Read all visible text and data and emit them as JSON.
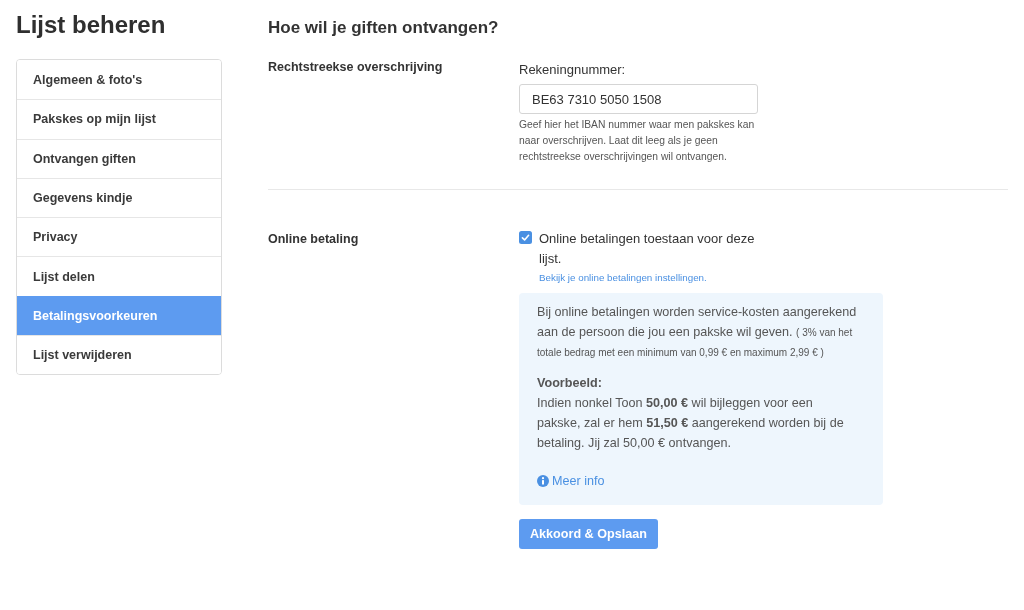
{
  "page_title": "Lijst beheren",
  "sidebar_items": [
    {
      "label": "Algemeen & foto's",
      "selected": false
    },
    {
      "label": "Pakskes op mijn lijst",
      "selected": false
    },
    {
      "label": "Ontvangen giften",
      "selected": false
    },
    {
      "label": "Gegevens kindje",
      "selected": false
    },
    {
      "label": "Privacy",
      "selected": false
    },
    {
      "label": "Lijst delen",
      "selected": false
    },
    {
      "label": "Betalingsvoorkeuren",
      "selected": true
    },
    {
      "label": "Lijst verwijderen",
      "selected": false
    }
  ],
  "heading": "Hoe wil je giften ontvangen?",
  "bank_transfer": {
    "label": "Rechtstreekse overschrijving",
    "field_label": "Rekeningnummer:",
    "value": "BE63 7310 5050 1508",
    "help": "Geef hier het IBAN nummer waar men pakskes kan naar overschrijven. Laat dit leeg als je geen rechtstreekse overschrijvingen wil ontvangen."
  },
  "online_payment": {
    "label": "Online betaling",
    "checkbox": {
      "label": "Online betalingen toestaan voor deze lijst.",
      "checked": true
    },
    "settings_link": "Bekijk je online betalingen instellingen.",
    "info": {
      "intro": "Bij online betalingen worden service-kosten aangerekend aan de persoon die jou een pakske wil geven.",
      "note": "( 3% van het totale bedrag met een minimum van 0,99 € en maximum 2,99 € )",
      "example_title": "Voorbeeld:",
      "example": "Indien nonkel Toon **50,00 €** wil bijleggen voor een pakske, zal er hem **51,50 €** aangerekend worden bij de betaling. Jij zal 50,00 € ontvangen.",
      "more_info": "Meer info"
    }
  },
  "save_button": "Akkoord & Opslaan"
}
